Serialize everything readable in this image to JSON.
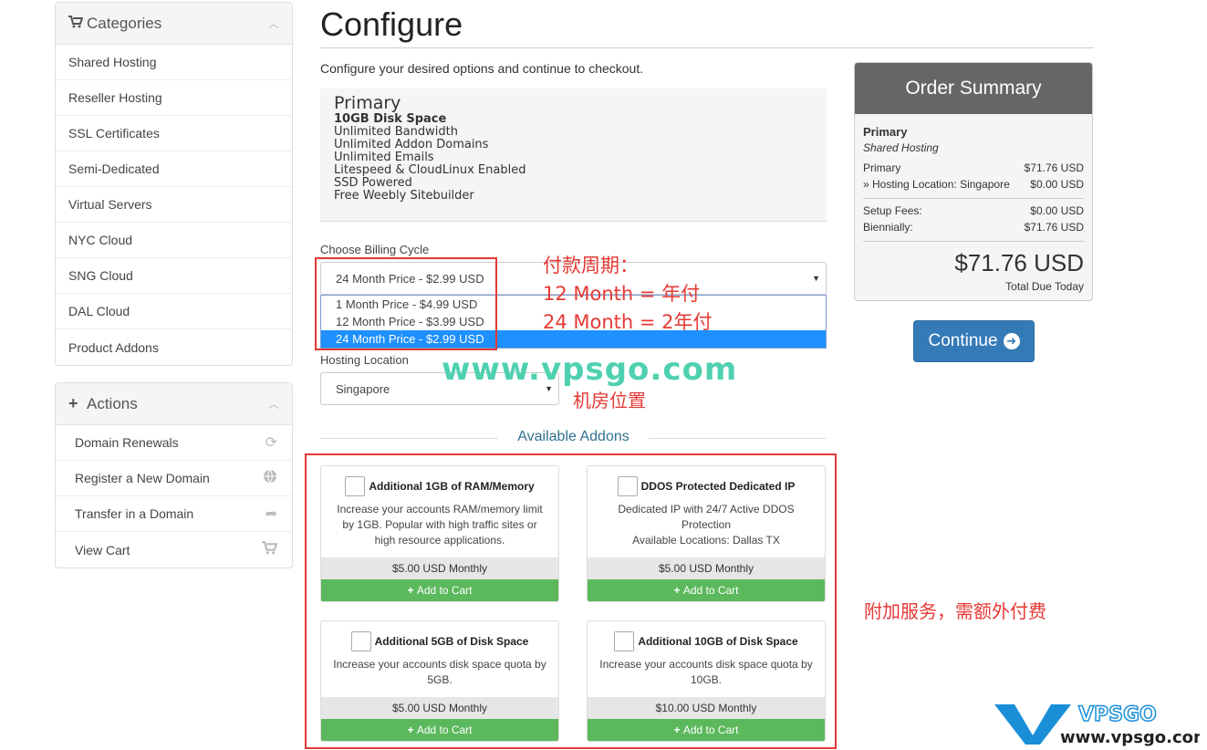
{
  "sidebar": {
    "categories_title": "Categories",
    "categories": [
      "Shared Hosting",
      "Reseller Hosting",
      "SSL Certificates",
      "Semi-Dedicated",
      "Virtual Servers",
      "NYC Cloud",
      "SNG Cloud",
      "DAL Cloud",
      "Product Addons"
    ],
    "actions_title": "Actions",
    "actions": [
      "Domain Renewals",
      "Register a New Domain",
      "Transfer in a Domain",
      "View Cart"
    ]
  },
  "page": {
    "title": "Configure",
    "subtitle": "Configure your desired options and continue to checkout."
  },
  "product": {
    "name": "Primary",
    "features": [
      "10GB Disk Space",
      "Unlimited Bandwidth",
      "Unlimited Addon Domains",
      "Unlimited Emails",
      "Litespeed & CloudLinux Enabled",
      "SSD Powered",
      "Free Weebly Sitebuilder"
    ]
  },
  "billing": {
    "label": "Choose Billing Cycle",
    "selected": "24 Month Price - $2.99 USD",
    "options": [
      "1 Month Price - $4.99 USD",
      "12 Month Price - $3.99 USD",
      "24 Month Price - $2.99 USD"
    ]
  },
  "location": {
    "label": "Hosting Location",
    "selected": "Singapore"
  },
  "annotations": {
    "billing_note_1": "付款周期：",
    "billing_note_2": "12 Month = 年付",
    "billing_note_3": "24 Month = 2年付",
    "location_note": "机房位置",
    "addons_note": "附加服务，需额外付费",
    "watermark": "www.vpsgo.com",
    "logo_big": "VPSGO",
    "logo_small": "www.vpsgo.com"
  },
  "addons": {
    "heading": "Available Addons",
    "add_label": "Add to Cart",
    "items": [
      {
        "title": "Additional 1GB of RAM/Memory",
        "desc": "Increase your accounts RAM/memory limit by 1GB. Popular with high traffic sites or high resource applications.",
        "price": "$5.00 USD Monthly"
      },
      {
        "title": "DDOS Protected Dedicated IP",
        "desc": "Dedicated IP with 24/7 Active DDOS Protection\nAvailable Locations: Dallas TX",
        "price": "$5.00 USD Monthly"
      },
      {
        "title": "Additional 5GB of Disk Space",
        "desc": "Increase your accounts disk space quota by 5GB.",
        "price": "$5.00 USD Monthly"
      },
      {
        "title": "Additional 10GB of Disk Space",
        "desc": "Increase your accounts disk space quota by 10GB.",
        "price": "$10.00 USD Monthly"
      }
    ]
  },
  "summary": {
    "title": "Order Summary",
    "product": "Primary",
    "group": "Shared Hosting",
    "lines": [
      {
        "label": "Primary",
        "value": "$71.76 USD"
      },
      {
        "label": "» Hosting Location: Singapore",
        "value": "$0.00 USD"
      }
    ],
    "fees": [
      {
        "label": "Setup Fees:",
        "value": "$0.00 USD"
      },
      {
        "label": "Biennially:",
        "value": "$71.76 USD"
      }
    ],
    "total": "$71.76 USD",
    "total_label": "Total Due Today"
  },
  "continue_label": "Continue",
  "colors": {
    "accent": "#337ab7",
    "green": "#5cb85c",
    "annotation_red": "#e53935",
    "watermark": "#4fd1b0"
  }
}
